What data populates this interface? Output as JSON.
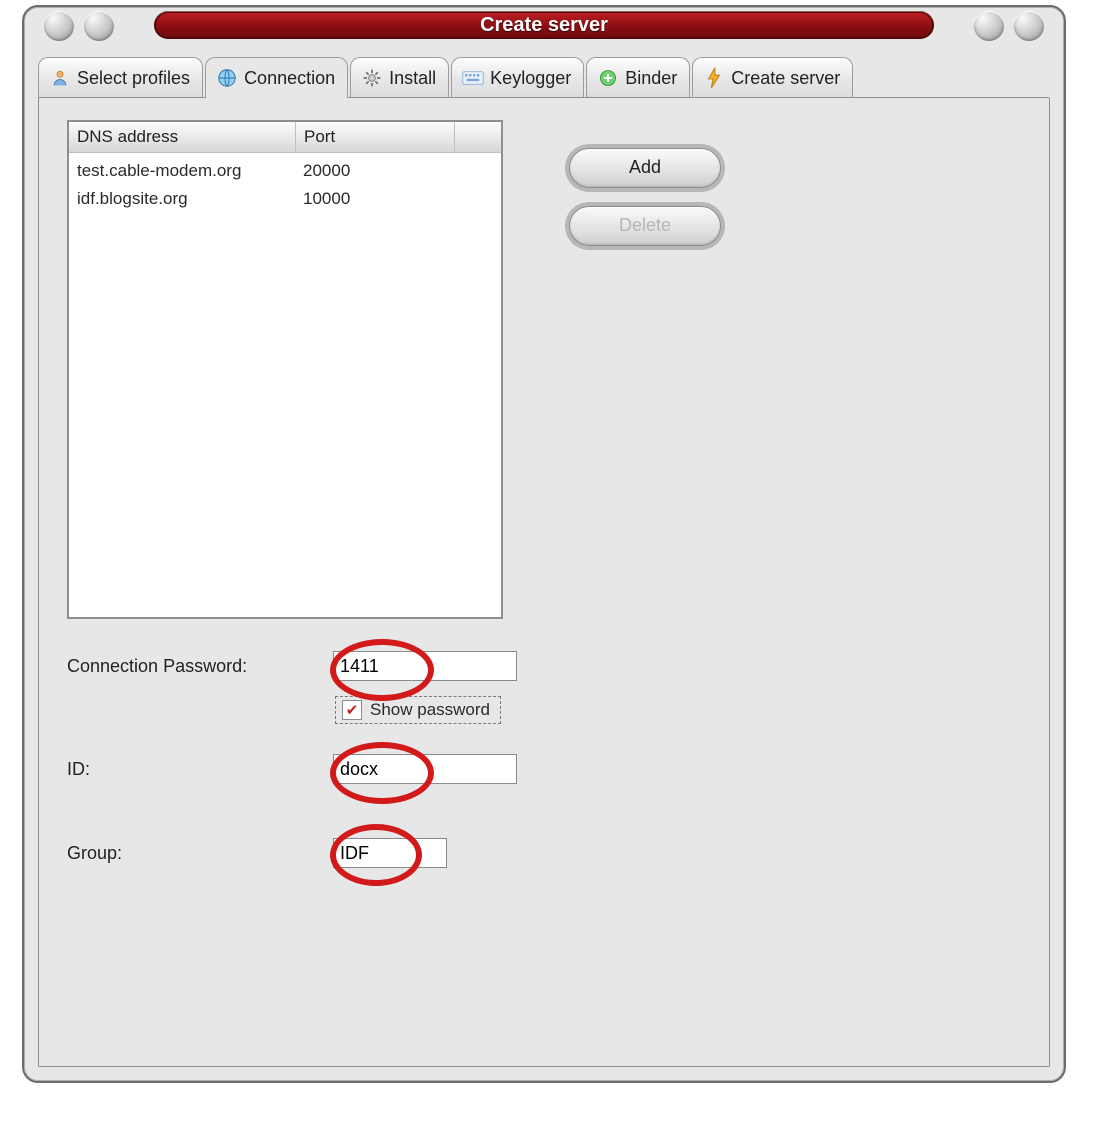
{
  "window": {
    "title": "Create server"
  },
  "tabs": {
    "items": [
      {
        "label": "Select profiles"
      },
      {
        "label": "Connection"
      },
      {
        "label": "Install"
      },
      {
        "label": "Keylogger"
      },
      {
        "label": "Binder"
      },
      {
        "label": "Create server"
      }
    ],
    "active_index": 1
  },
  "listview": {
    "columns": {
      "dns": "DNS address",
      "port": "Port"
    },
    "rows": [
      {
        "dns": "test.cable-modem.org",
        "port": "20000"
      },
      {
        "dns": "idf.blogsite.org",
        "port": "10000"
      }
    ]
  },
  "buttons": {
    "add": "Add",
    "delete": "Delete"
  },
  "form": {
    "password_label": "Connection Password:",
    "password_value": "1411",
    "show_password_label": "Show password",
    "show_password_checked": true,
    "id_label": "ID:",
    "id_value": "docx",
    "group_label": "Group:",
    "group_value": "IDF"
  },
  "colors": {
    "accent": "#8a0e12",
    "highlight": "#d31a1a"
  }
}
